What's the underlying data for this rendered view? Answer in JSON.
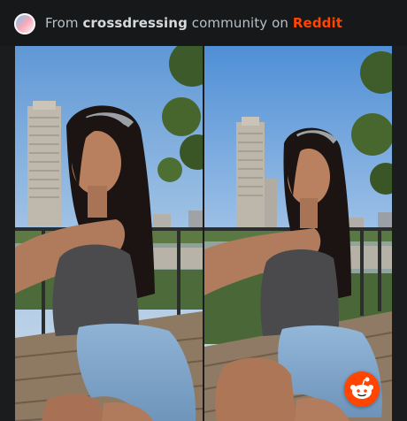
{
  "embed": {
    "prefix": "From ",
    "community": "crossdressing",
    "middle": " community on ",
    "platform": "Reddit"
  },
  "gallery": {
    "photos": [
      {
        "name": "photo-left"
      },
      {
        "name": "photo-right"
      }
    ]
  },
  "colors": {
    "platform_accent": "#ff4500",
    "background": "#1a1c1e"
  },
  "icons": {
    "community": "community-icon",
    "badge": "reddit-alien-icon"
  }
}
